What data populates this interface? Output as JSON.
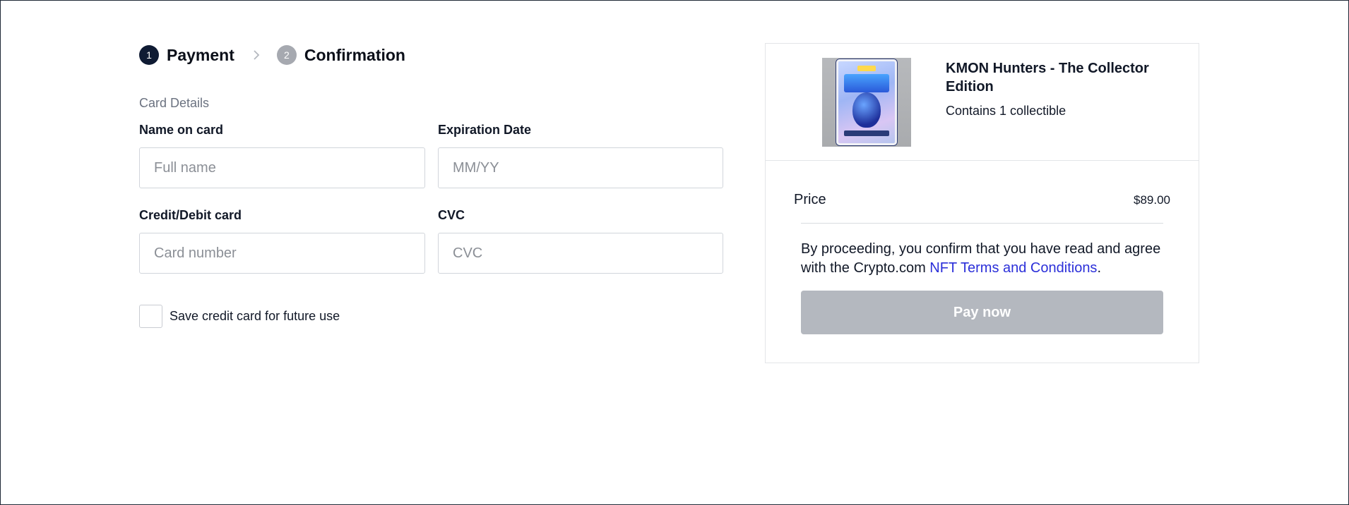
{
  "stepper": {
    "steps": [
      {
        "number": "1",
        "label": "Payment",
        "state": "active"
      },
      {
        "number": "2",
        "label": "Confirmation",
        "state": "inactive"
      }
    ]
  },
  "form": {
    "section_title": "Card Details",
    "name_on_card": {
      "label": "Name on card",
      "placeholder": "Full name",
      "value": ""
    },
    "expiration_date": {
      "label": "Expiration Date",
      "placeholder": "MM/YY",
      "value": ""
    },
    "card_number": {
      "label": "Credit/Debit card",
      "placeholder": "Card number",
      "value": ""
    },
    "cvc": {
      "label": "CVC",
      "placeholder": "CVC",
      "value": ""
    },
    "save_card_label": "Save credit card for future use",
    "save_card_checked": false
  },
  "summary": {
    "product_title": "KMON Hunters - The Collector Edition",
    "product_subtitle": "Contains 1 collectible",
    "price_label": "Price",
    "price_value": "$89.00",
    "terms_prefix": "By proceeding, you confirm that you have read and agree with the Crypto.com ",
    "terms_link": "NFT Terms and Conditions",
    "terms_suffix": ".",
    "pay_button_label": "Pay now",
    "pay_button_enabled": false
  },
  "colors": {
    "active_step": "#0f1b33",
    "inactive_step": "#a6a9b0",
    "link": "#2b2fd9",
    "disabled_button": "#b4b8bf"
  }
}
